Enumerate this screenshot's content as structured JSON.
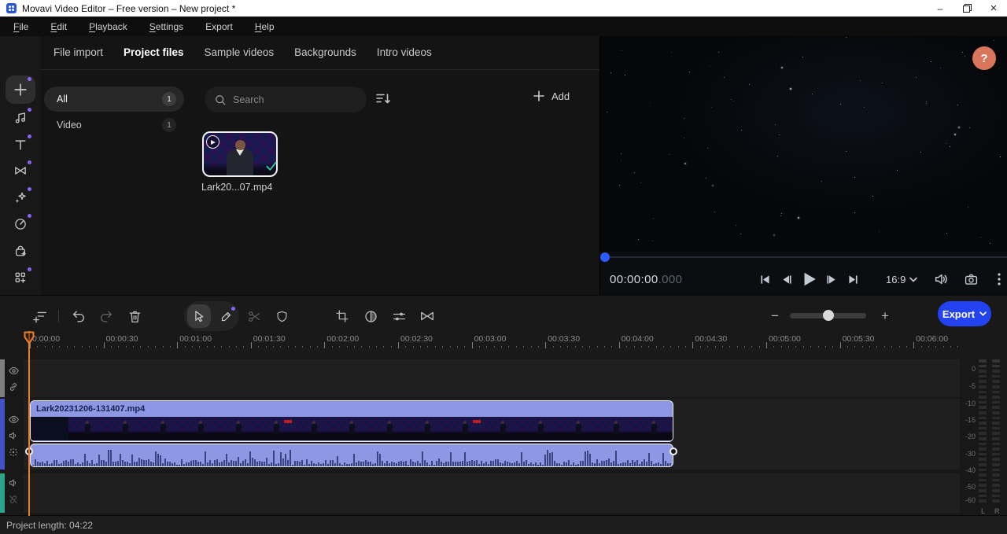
{
  "titlebar": {
    "title": "Movavi Video Editor – Free version – New project *"
  },
  "window_controls": {
    "minimize": "–",
    "restore": "restore",
    "close": "×"
  },
  "menu": {
    "items": [
      {
        "label": "File",
        "accel": 0
      },
      {
        "label": "Edit",
        "accel": 0
      },
      {
        "label": "Playback",
        "accel": 0
      },
      {
        "label": "Settings",
        "accel": 0
      },
      {
        "label": "Export",
        "accel": -1
      },
      {
        "label": "Help",
        "accel": 0
      }
    ]
  },
  "sidebar": {
    "items": [
      {
        "id": "import-media",
        "icon": "plus",
        "selected": true,
        "dot": true
      },
      {
        "id": "audio",
        "icon": "music",
        "selected": false,
        "dot": true
      },
      {
        "id": "titles",
        "icon": "text",
        "selected": false,
        "dot": true
      },
      {
        "id": "transitions",
        "icon": "bowtie",
        "selected": false,
        "dot": true
      },
      {
        "id": "effects",
        "icon": "sparkles",
        "selected": false,
        "dot": true
      },
      {
        "id": "filters",
        "icon": "dial",
        "selected": false,
        "dot": true
      },
      {
        "id": "stickers",
        "icon": "bag-plus",
        "selected": false,
        "dot": false
      },
      {
        "id": "more-tools",
        "icon": "grid-plus",
        "selected": false,
        "dot": true
      }
    ]
  },
  "media_panel": {
    "tabs": [
      "File import",
      "Project files",
      "Sample videos",
      "Backgrounds",
      "Intro videos"
    ],
    "active_tab_index": 1,
    "filters": [
      {
        "label": "All",
        "count": "1",
        "selected": true
      },
      {
        "label": "Video",
        "count": "1",
        "selected": false
      }
    ],
    "search_placeholder": "Search",
    "add_label": "Add",
    "clip_label": "Lark20...07.mp4"
  },
  "preview": {
    "timecode": "00:00:00",
    "timecode_ms": ".000",
    "aspect_ratio": "16:9",
    "help_label": "?"
  },
  "timeline": {
    "export_label": "Export",
    "ruler_labels": [
      "0:00:00",
      "00:00:30",
      "00:01:00",
      "00:01:30",
      "00:02:00",
      "00:02:30",
      "00:03:00",
      "00:03:30",
      "00:04:00",
      "00:04:30",
      "00:05:00",
      "00:05:30",
      "00:06:00"
    ],
    "clip_label": "Lark20231206-131407.mp4",
    "filmstrip_frames": 17,
    "red_sign_frames": [
      6,
      11
    ],
    "meter": {
      "labels": [
        "0",
        "-5",
        "-10",
        "-15",
        "-20",
        "-30",
        "-40",
        "-50",
        "-60"
      ],
      "label_offsets": [
        20,
        42,
        64,
        85,
        106,
        128,
        149,
        170,
        187
      ],
      "channels": [
        "L",
        "R"
      ]
    }
  },
  "statusbar": {
    "text": "Project length: 04:22"
  },
  "colors": {
    "accent_blue": "#2342f0",
    "clip_fill": "#8d97e4",
    "waveform": "#39437f",
    "playhead_orange": "#e87f2a",
    "help_coral": "#d9755a",
    "check_green": "#35c79a",
    "track_stripe_overlay": "#7f7f7f",
    "track_stripe_video": "#4352c7",
    "track_stripe_audio": "#2ea38b"
  }
}
